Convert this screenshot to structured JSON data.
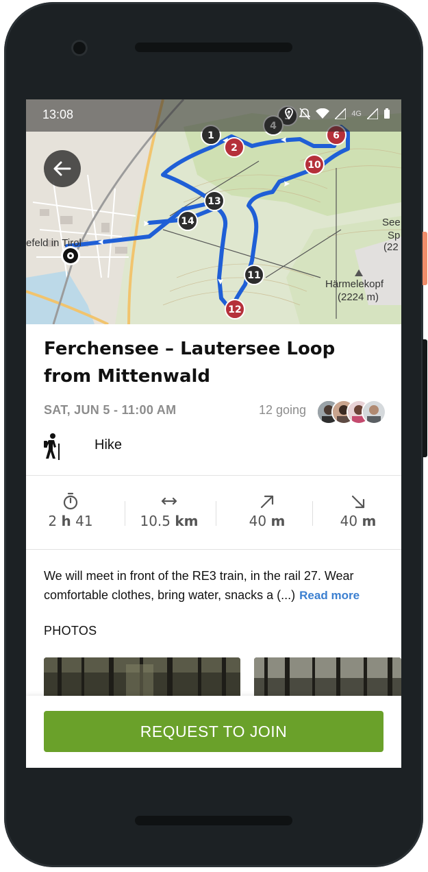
{
  "status_bar": {
    "time": "13:08",
    "network": "4G"
  },
  "map": {
    "town_label": "efeld in Tirol",
    "peak_name": "Härmelekopf",
    "peak_elevation": "(2224 m)",
    "edge_label_1": "See",
    "edge_label_2": "Sp",
    "edge_label_3": "(22",
    "waypoints": [
      {
        "label": "1",
        "type": "dark"
      },
      {
        "label": "2",
        "type": "red"
      },
      {
        "label": "3",
        "type": "dark"
      },
      {
        "label": "4",
        "type": "dark"
      },
      {
        "label": "6",
        "type": "red"
      },
      {
        "label": "10",
        "type": "red"
      },
      {
        "label": "11",
        "type": "dark"
      },
      {
        "label": "12",
        "type": "red"
      },
      {
        "label": "13",
        "type": "dark"
      },
      {
        "label": "14",
        "type": "dark"
      }
    ],
    "colors": {
      "route": "#1f5fd6",
      "red_marker": "#b5303a",
      "dark_marker": "#2d2d2d"
    }
  },
  "event": {
    "title": "Ferchensee – Lautersee Loop from Mittenwald",
    "date": "SAT, JUN 5 - 11:00 AM",
    "going": "12 going",
    "activity": "Hike"
  },
  "stats": {
    "duration_prefix": "2",
    "duration_unit": "h",
    "duration_suffix": "41",
    "distance": "10.5",
    "distance_unit": "km",
    "ascent": "40",
    "ascent_unit": "m",
    "descent": "40",
    "descent_unit": "m"
  },
  "description": {
    "text": "We will meet in front of the RE3 train, in the rail 27. Wear comfortable clothes, bring water, snacks a (...)",
    "read_more": "Read more"
  },
  "photos": {
    "heading": "PHOTOS"
  },
  "join_button": "REQUEST TO JOIN",
  "accent_colors": {
    "join": "#6aa12a",
    "link": "#3b7fd0"
  }
}
